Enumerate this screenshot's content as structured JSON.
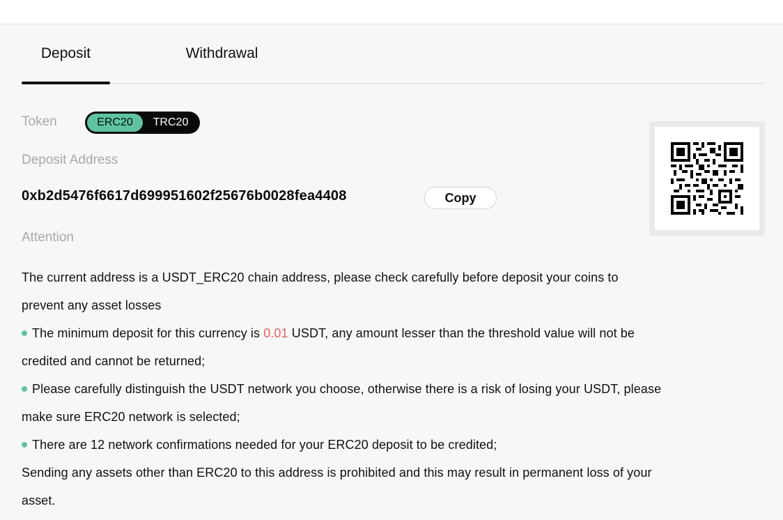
{
  "tabs": [
    {
      "label": "Deposit",
      "active": true
    },
    {
      "label": "Withdrawal",
      "active": false
    }
  ],
  "token": {
    "label": "Token",
    "options": [
      "ERC20",
      "TRC20"
    ],
    "selected": "ERC20"
  },
  "deposit": {
    "label": "Deposit Address",
    "address": "0xb2d5476f6617d699951602f25676b0028fea4408",
    "copy_label": "Copy"
  },
  "attention": {
    "label": "Attention",
    "intro": "The current address is a USDT_ERC20 chain address, please check carefully before deposit your coins to prevent any asset losses",
    "min_pre": "The minimum deposit for this currency is ",
    "min_value": "0.01",
    "min_post": " USDT, any amount lesser than the threshold value will not be credited and cannot be returned;",
    "network": "Please carefully distinguish the USDT network you choose, otherwise there is a risk of losing your USDT, please make sure ERC20 network is selected;",
    "confirmations": "There are 12 network confirmations needed for your ERC20 deposit to be credited;",
    "warning": "Sending any assets other than ERC20 to this address is prohibited and this may result in permanent loss of your asset."
  },
  "colors": {
    "accent": "#5fc3a0",
    "highlight": "#e2645e",
    "muted_label": "#a9a9a9"
  },
  "icons": {
    "qr": "qr-code-icon",
    "bullet": "green-dot"
  }
}
